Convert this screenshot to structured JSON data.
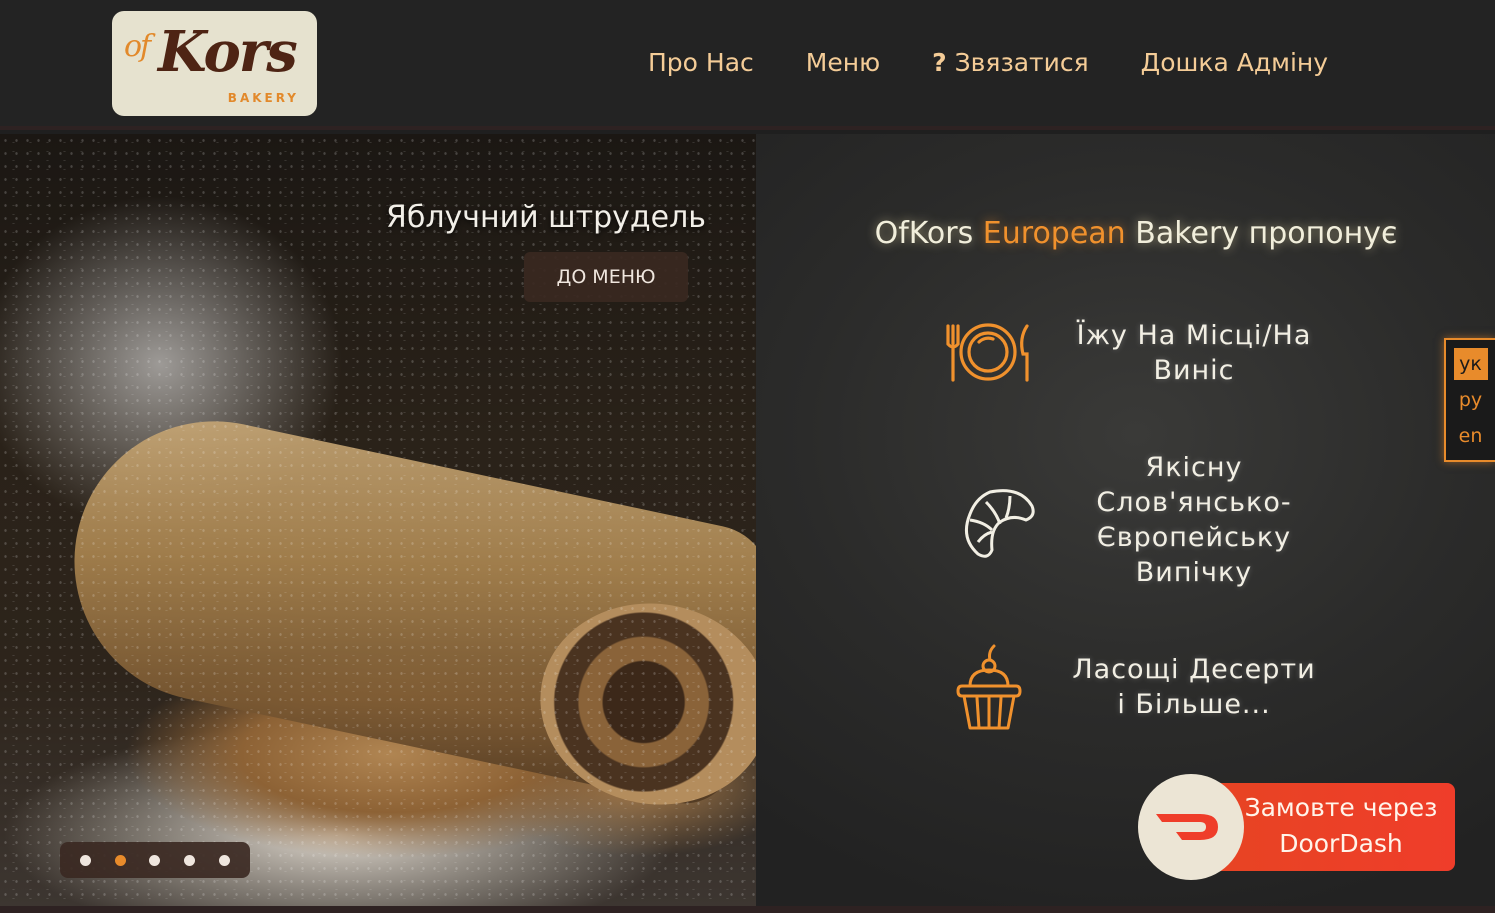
{
  "logo": {
    "of": "of",
    "kors": "Kors",
    "bakery": "BAKERY"
  },
  "nav": {
    "about": "Про Нас",
    "menu": "Меню",
    "contact_icon": "?",
    "contact": "Звязатися",
    "admin": "Дошка Адміну"
  },
  "hero": {
    "title": "Яблучний штрудель",
    "button": "ДО МЕНЮ",
    "slides": 5,
    "active_slide": 2
  },
  "board": {
    "title_a": "OfKors ",
    "title_b": "European",
    "title_c": " Bakery пропонує",
    "features": [
      {
        "icon": "plate-cutlery-icon",
        "line1": "Їжу На Місці/На",
        "line2": "Винiс"
      },
      {
        "icon": "croissant-icon",
        "line1": "Якісну",
        "line2": "Слов'янсько-",
        "line3": "Європейську",
        "line4": "Випічку"
      },
      {
        "icon": "cupcake-icon",
        "line1": "Ласощі Десерти",
        "line2": "і Більше..."
      }
    ]
  },
  "lang": {
    "uk": "ук",
    "ru": "ру",
    "en": "en",
    "active": "uk"
  },
  "doordash": {
    "line1": "Замовте через",
    "line2": "DoorDash"
  },
  "colors": {
    "accent": "#e88b2b",
    "nav_text": "#f4cc97",
    "doordash": "#ef3d2a"
  }
}
